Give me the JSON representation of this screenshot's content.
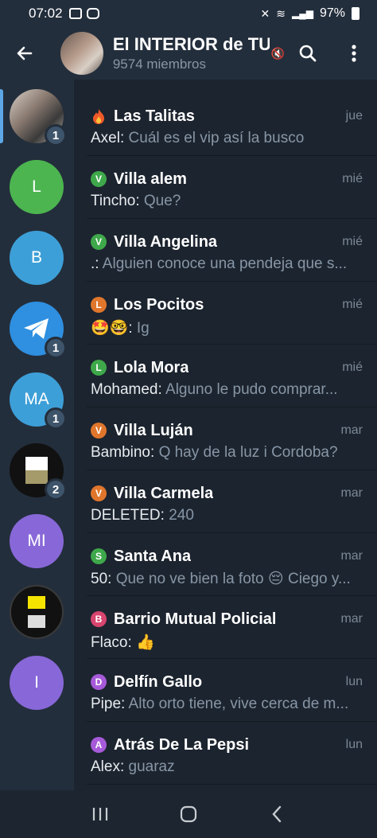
{
  "status": {
    "time": "07:02",
    "battery": "97%"
  },
  "header": {
    "title": "El INTERIOR de TUC",
    "subtitle": "9574 miembros"
  },
  "folders": [
    {
      "badge": "1",
      "color": "#8a7a70"
    },
    {
      "label": "L",
      "color": "#4cb550"
    },
    {
      "label": "B",
      "color": "#3d9fd8"
    },
    {
      "badge": "1",
      "color": "#2f8fe0",
      "icon": "telegram-icon"
    },
    {
      "label": "MA",
      "badge": "1",
      "color": "#3d9fd8"
    },
    {
      "badge": "2",
      "color": "#111111"
    },
    {
      "label": "MI",
      "color": "#8868d8"
    },
    {
      "color": "#111111"
    },
    {
      "label": "I",
      "color": "#8868d8"
    }
  ],
  "chats": [
    {
      "name": "Las Talitas",
      "date": "jue",
      "sender": "Axel:",
      "message": "Cuál es el vip así la busco",
      "topic": "fire",
      "topic_color": "#ef5a2a"
    },
    {
      "name": "Villa alem",
      "date": "mié",
      "sender": "Tincho:",
      "message": "Que?",
      "topic": "V",
      "topic_color": "#3ea84a"
    },
    {
      "name": "Villa Angelina",
      "date": "mié",
      "sender": ".:",
      "message": "Alguien conoce una pendeja que s...",
      "topic": "V",
      "topic_color": "#3ea84a"
    },
    {
      "name": "Los Pocitos",
      "date": "mié",
      "sender": "🤩🤓:",
      "message": "Ig",
      "topic": "L",
      "topic_color": "#e0762c"
    },
    {
      "name": "Lola Mora",
      "date": "mié",
      "sender": "Mohamed:",
      "message": "Alguno le pudo comprar...",
      "topic": "L",
      "topic_color": "#3ea84a"
    },
    {
      "name": "Villa Luján",
      "date": "mar",
      "sender": "Bambino:",
      "message": "Q hay de la luz i Cordoba?",
      "topic": "V",
      "topic_color": "#e0762c"
    },
    {
      "name": "Villa Carmela",
      "date": "mar",
      "sender": "DELETED:",
      "message": "240",
      "topic": "V",
      "topic_color": "#e0762c"
    },
    {
      "name": "Santa Ana",
      "date": "mar",
      "sender": "50:",
      "message": "Que no ve bien la foto 😔 Ciego y...",
      "topic": "S",
      "topic_color": "#3ea84a"
    },
    {
      "name": "Barrio Mutual Policial",
      "date": "mar",
      "sender": "Flaco:",
      "message": "👍",
      "topic": "B",
      "topic_color": "#d8456f"
    },
    {
      "name": "Delfín Gallo",
      "date": "lun",
      "sender": "Pipe:",
      "message": "Alto orto tiene, vive cerca de m...",
      "topic": "D",
      "topic_color": "#a65ad8"
    },
    {
      "name": "Atrás De La Pepsi",
      "date": "lun",
      "sender": "Alex:",
      "message": "guaraz",
      "topic": "A",
      "topic_color": "#a65ad8"
    }
  ]
}
